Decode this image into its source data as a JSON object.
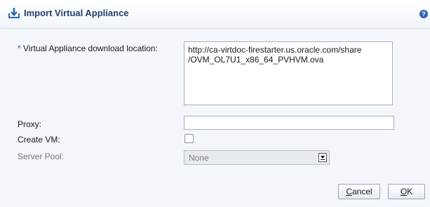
{
  "dialog": {
    "title": "Import Virtual Appliance",
    "help_icon": "help-icon",
    "title_icon": "download-icon"
  },
  "form": {
    "location": {
      "required_marker": "*",
      "label": "Virtual Appliance download location:",
      "value_lines": [
        "http://ca-virtdoc-firestarter.us.oracle.com/share",
        "/OVM_OL7U1_x86_64_PVHVM.ova"
      ]
    },
    "proxy": {
      "label": "Proxy:",
      "value": ""
    },
    "create_vm": {
      "label": "Create VM:",
      "checked": false
    },
    "server_pool": {
      "label": "Server Pool:",
      "value": "None",
      "disabled": true
    }
  },
  "buttons": {
    "cancel": {
      "label_first": "C",
      "label_rest": "ancel"
    },
    "ok": {
      "label_first": "O",
      "label_rest": "K"
    }
  },
  "colors": {
    "title_text": "#233f6b",
    "accent": "#2a66b4",
    "background": "#f3f6fa"
  }
}
